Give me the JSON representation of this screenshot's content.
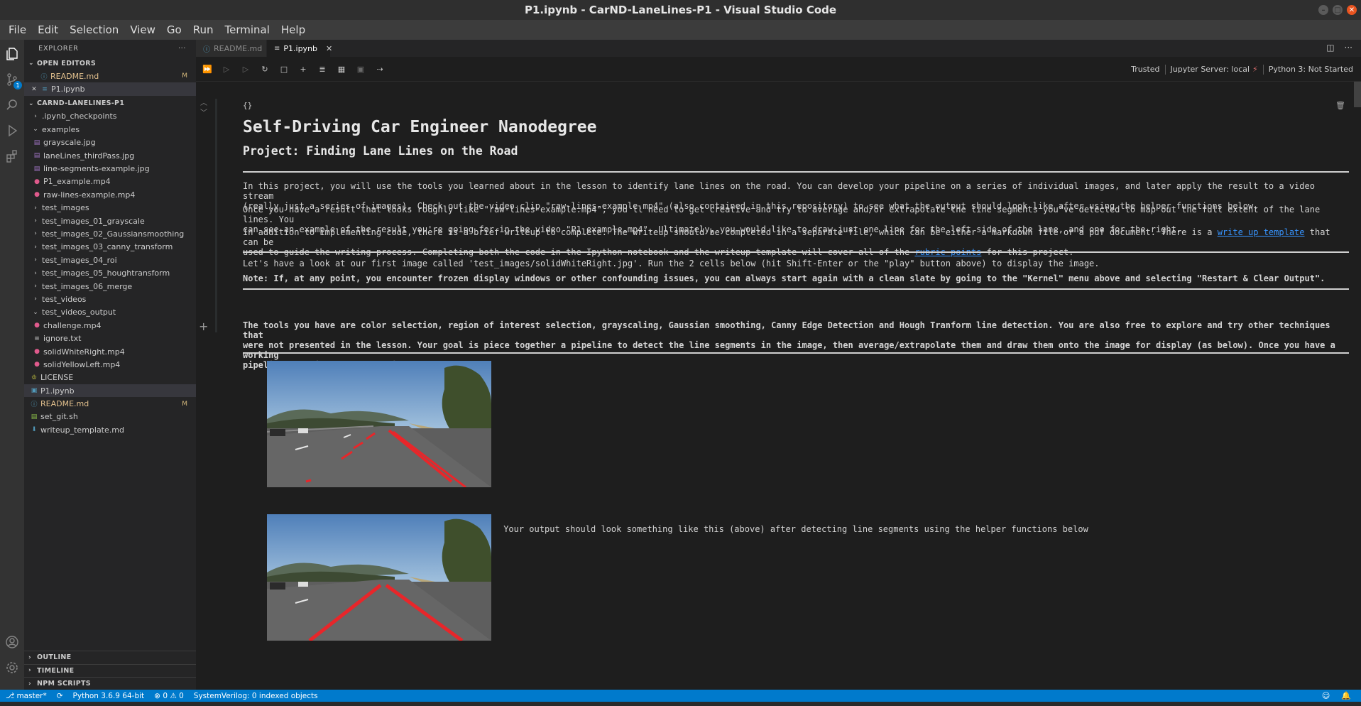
{
  "window": {
    "title": "P1.ipynb - CarND-LaneLines-P1 - Visual Studio Code"
  },
  "menu": [
    "File",
    "Edit",
    "Selection",
    "View",
    "Go",
    "Run",
    "Terminal",
    "Help"
  ],
  "activity_badge": "1",
  "sidebar": {
    "header": "EXPLORER",
    "more": "···",
    "open_editors_title": "OPEN EDITORS",
    "open_editors": [
      {
        "name": "README.md",
        "icon": "info-icon",
        "badge": "M"
      },
      {
        "name": "P1.ipynb",
        "icon": "notebook-icon",
        "badge": ""
      }
    ],
    "project_title": "CARND-LANELINES-P1",
    "tree": [
      {
        "name": ".ipynb_checkpoints",
        "type": "folder",
        "depth": 0,
        "open": false
      },
      {
        "name": "examples",
        "type": "folder",
        "depth": 0,
        "open": true
      },
      {
        "name": "grayscale.jpg",
        "type": "image",
        "depth": 1
      },
      {
        "name": "laneLines_thirdPass.jpg",
        "type": "image",
        "depth": 1
      },
      {
        "name": "line-segments-example.jpg",
        "type": "image",
        "depth": 1
      },
      {
        "name": "P1_example.mp4",
        "type": "video",
        "depth": 1
      },
      {
        "name": "raw-lines-example.mp4",
        "type": "video",
        "depth": 1
      },
      {
        "name": "test_images",
        "type": "folder",
        "depth": 0,
        "open": false
      },
      {
        "name": "test_images_01_grayscale",
        "type": "folder",
        "depth": 0,
        "open": false
      },
      {
        "name": "test_images_02_Gaussiansmoothing",
        "type": "folder",
        "depth": 0,
        "open": false
      },
      {
        "name": "test_images_03_canny_transform",
        "type": "folder",
        "depth": 0,
        "open": false
      },
      {
        "name": "test_images_04_roi",
        "type": "folder",
        "depth": 0,
        "open": false
      },
      {
        "name": "test_images_05_houghtransform",
        "type": "folder",
        "depth": 0,
        "open": false
      },
      {
        "name": "test_images_06_merge",
        "type": "folder",
        "depth": 0,
        "open": false
      },
      {
        "name": "test_videos",
        "type": "folder",
        "depth": 0,
        "open": false
      },
      {
        "name": "test_videos_output",
        "type": "folder",
        "depth": 0,
        "open": true
      },
      {
        "name": "challenge.mp4",
        "type": "video",
        "depth": 1
      },
      {
        "name": "ignore.txt",
        "type": "text",
        "depth": 1
      },
      {
        "name": "solidWhiteRight.mp4",
        "type": "video",
        "depth": 1
      },
      {
        "name": "solidYellowLeft.mp4",
        "type": "video",
        "depth": 1
      },
      {
        "name": "LICENSE",
        "type": "license",
        "depth": 0
      },
      {
        "name": "P1.ipynb",
        "type": "notebook",
        "depth": 0,
        "selected": true
      },
      {
        "name": "README.md",
        "type": "info",
        "depth": 0,
        "badge": "M"
      },
      {
        "name": "set_git.sh",
        "type": "shell",
        "depth": 0
      },
      {
        "name": "writeup_template.md",
        "type": "markdown",
        "depth": 0
      }
    ],
    "bottom_sections": [
      "OUTLINE",
      "TIMELINE",
      "NPM SCRIPTS"
    ]
  },
  "tabs": [
    {
      "label": "README.md",
      "active": false
    },
    {
      "label": "P1.ipynb",
      "active": true
    }
  ],
  "notebook_toolbar": {
    "trusted": "Trusted",
    "server": "Jupyter Server: local",
    "kernel": "Python 3: Not Started"
  },
  "cell": {
    "type_marker": "{}",
    "h1": "Self-Driving Car Engineer Nanodegree",
    "h2": "Project: Finding Lane Lines on the Road",
    "p1a": "In this project, you will use the tools you learned about in the lesson to identify lane lines on the road. You can develop your pipeline on a series of individual images, and later apply the result to a video stream",
    "p1b": "(really just a series of images). Check out the video clip \"raw-lines-example.mp4\" (also contained in this repository) to see what the output should look like after using the helper functions below.",
    "p2a": "Once you have a result that looks roughly like \"raw-lines-example.mp4\", you'll need to get creative and try to average and/or extrapolate the line segments you've detected to map out the full extent of the lane lines. You",
    "p2b": "can see an example of the result you're going for in the video \"P1_example.mp4\". Ultimately, you would like to draw just one line for the left side of the lane, and one for the right.",
    "p3a_pre": "In addition to implementing code, there is a brief writeup to complete. The writeup should be completed in a separate file, which can be either a markdown file or a pdf document. There is a ",
    "p3a_link": "write up template",
    "p3a_post": " that can be",
    "p3b_pre": "used to guide the writing process. Completing both the code in the Ipython notebook and the writeup template will cover all of the ",
    "p3b_link": "rubric points",
    "p3b_post": " for this project.",
    "p4": "Let's have a look at our first image called 'test_images/solidWhiteRight.jpg'. Run the 2 cells below (hit Shift-Enter or the \"play\" button above) to display the image.",
    "p5": "Note: If, at any point, you encounter frozen display windows or other confounding issues, you can always start again with a clean slate by going to the \"Kernel\" menu above and selecting \"Restart & Clear Output\".",
    "p6a": "The tools you have are color selection, region of interest selection, grayscaling, Gaussian smoothing, Canny Edge Detection and Hough Tranform line detection. You are also free to explore and try other techniques that",
    "p6b": "were not presented in the lesson. Your goal is piece together a pipeline to detect the line segments in the image, then average/extrapolate them and draw them onto the image for display (as below). Once you have a working",
    "p6c": "pipeline, try it out on the video stream below.",
    "caption": "Your output should look something like this (above) after detecting line segments using the helper functions below"
  },
  "status": {
    "branch": "master*",
    "python": "Python 3.6.9 64-bit",
    "problems": "0",
    "warnings": "0",
    "sysverilog": "SystemVerilog: 0 indexed objects"
  },
  "colors": {
    "accent": "#007acc",
    "link": "#3794ff",
    "lane_red": "#e8262a"
  }
}
